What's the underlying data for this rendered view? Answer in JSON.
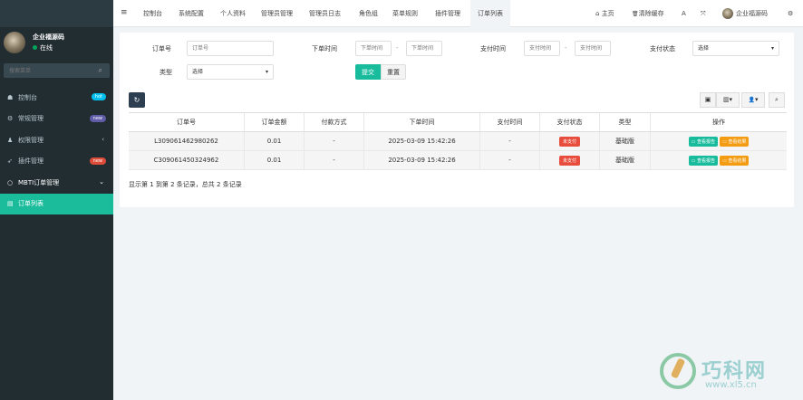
{
  "sidebar": {
    "user_name": "企业福源码",
    "user_status": "在线",
    "search_placeholder": "搜索菜单",
    "items": [
      {
        "icon": "dashboard-icon",
        "glyph": "☗",
        "label": "控制台",
        "badge": "hot",
        "badge_color": "#00c0ef"
      },
      {
        "icon": "cogs-icon",
        "glyph": "⚙",
        "label": "常规管理",
        "badge": "new",
        "badge_color": "#605ca8"
      },
      {
        "icon": "group-icon",
        "glyph": "♟",
        "label": "权限管理",
        "arrow": "‹"
      },
      {
        "icon": "rocket-icon",
        "glyph": "➶",
        "label": "插件管理",
        "badge": "new",
        "badge_color": "#dd4b39"
      },
      {
        "icon": "circle-icon",
        "glyph": "○",
        "label": "MBTI订单管理",
        "arrow": "⌄"
      },
      {
        "icon": "list-icon",
        "glyph": "▤",
        "label": "订单列表",
        "active": true
      }
    ]
  },
  "topnav": {
    "hamburger": "≡",
    "tabs": [
      "控制台",
      "系统配置",
      "个人资料",
      "管理员管理",
      "管理员日志",
      "角色组",
      "菜单规则",
      "插件管理",
      "订单列表"
    ],
    "active_tab": "订单列表",
    "home_icon": "⌂",
    "home_label": "主页",
    "clear_icon": "🗑",
    "clear_label": "清除缓存",
    "lang_icon": "A",
    "fullscreen_icon": "⤧",
    "user_label": "企业福源码",
    "settings_icon": "⚙"
  },
  "filters": {
    "order_no_label": "订单号",
    "order_no_placeholder": "订单号",
    "created_label": "下单时间",
    "created_from_placeholder": "下单时间",
    "created_to_placeholder": "下单时间",
    "dash": "-",
    "paid_label": "支付时间",
    "paid_from_placeholder": "支付时间",
    "paid_to_placeholder": "支付时间",
    "status_label": "支付状态",
    "status_value": "选择",
    "type_label": "类型",
    "type_value": "选择",
    "submit": "提交",
    "reset": "重置"
  },
  "toolbar": {
    "refresh_icon": "↻",
    "export_icon": "▣",
    "columns_icon": "▥",
    "user_icon": "👤",
    "search_icon": "⌕",
    "dropdown": "▾"
  },
  "table": {
    "columns": [
      "订单号",
      "订单金额",
      "付款方式",
      "下单时间",
      "支付时间",
      "支付状态",
      "类型",
      "操作"
    ],
    "rows": [
      {
        "order_no": "L309061462980262",
        "amount": "0.01",
        "pay_method": "-",
        "created": "2025-03-09 15:42:26",
        "paid": "-",
        "status": "未支付",
        "type": "基础版",
        "action1": "查看报告",
        "action2": "查看结果"
      },
      {
        "order_no": "C309061450324962",
        "amount": "0.01",
        "pay_method": "-",
        "created": "2025-03-09 15:42:26",
        "paid": "-",
        "status": "未支付",
        "type": "基础版",
        "action1": "查看报告",
        "action2": "查看结果"
      }
    ]
  },
  "pager_text": "显示第 1 到第 2 条记录，总共 2 条记录",
  "watermark": {
    "title": "巧科网",
    "url": "www.xl5.cn"
  },
  "colors": {
    "accent": "#18bc9c",
    "sidebar_bg": "#222d32",
    "danger": "#e74c3c",
    "warning": "#f39c12"
  }
}
